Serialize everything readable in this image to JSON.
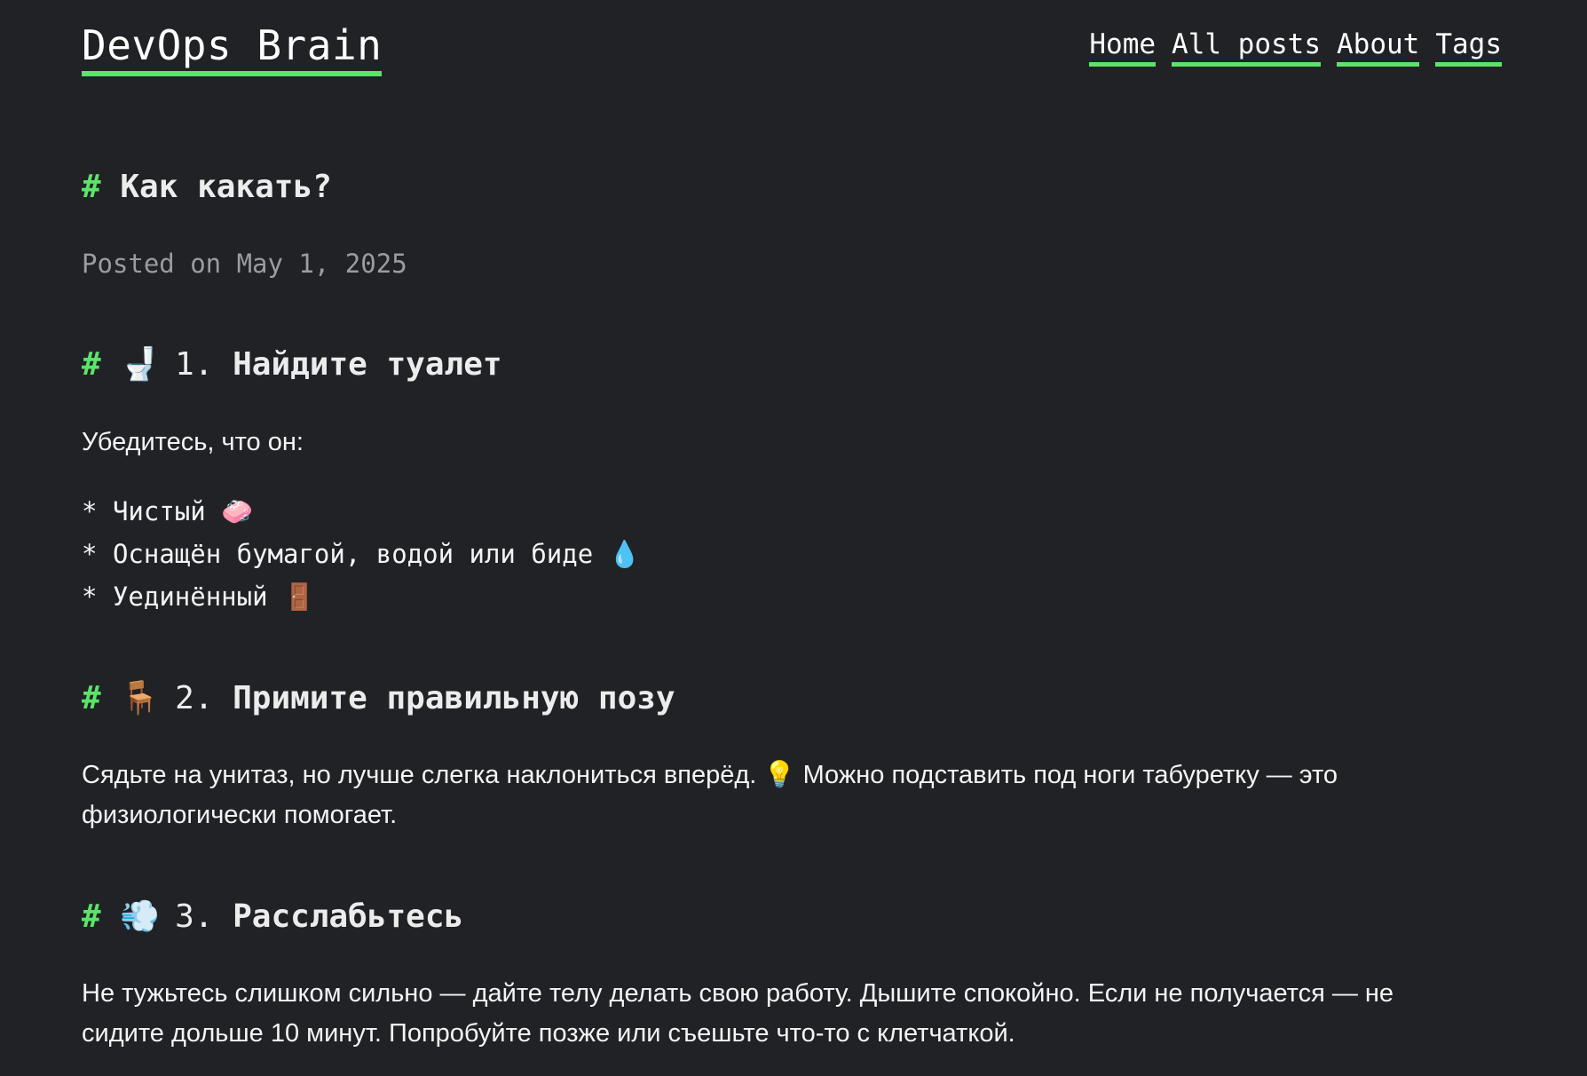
{
  "site": {
    "logo": "DevOps Brain",
    "nav": [
      "Home",
      "All posts",
      "About",
      "Tags"
    ]
  },
  "post": {
    "hash": "#",
    "title": "Как какать?",
    "meta": "Posted on May 1, 2025",
    "sections": [
      {
        "emoji": "🚽",
        "number": "1.",
        "title": "Найдите туалет",
        "intro": "Убедитесь, что он:",
        "bullets": [
          {
            "marker": "*",
            "text": "Чистый",
            "emoji": "🧼"
          },
          {
            "marker": "*",
            "text": "Оснащён бумагой, водой или биде",
            "emoji": "💧"
          },
          {
            "marker": "*",
            "text": "Уединённый",
            "emoji": "🚪"
          }
        ]
      },
      {
        "emoji": "🪑",
        "number": "2.",
        "title": "Примите правильную позу",
        "body_before": "Сядьте на унитаз, но лучше слегка наклониться вперёд.",
        "body_emoji": "💡",
        "body_after": "Можно подставить под ноги табуретку — это физиологически помогает."
      },
      {
        "emoji": "💨",
        "number": "3.",
        "title": "Расслабьтесь",
        "body": "Не тужьтесь слишком сильно — дайте телу делать свою работу. Дышите спокойно. Если не получается — не сидите дольше 10 минут. Попробуйте позже или съешьте что-то с клетчаткой."
      }
    ]
  },
  "colors": {
    "background": "#212226",
    "accent": "#5ce36a",
    "text": "#f1f1f1",
    "muted": "#9b9ca0"
  }
}
